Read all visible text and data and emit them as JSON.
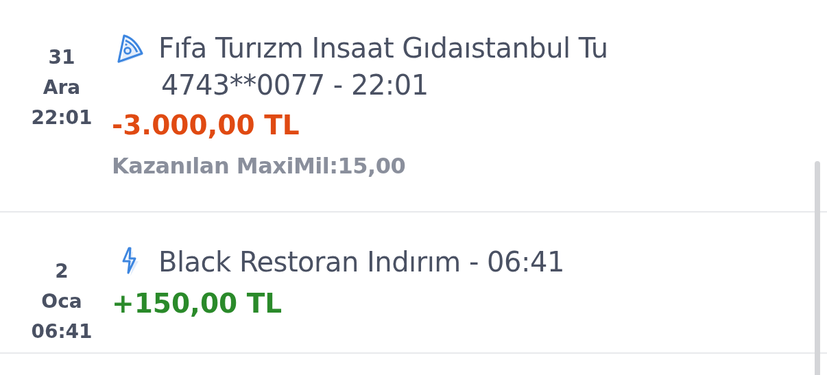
{
  "transactions": [
    {
      "day": "31",
      "month": "Ara",
      "time": "22:01",
      "kind": "pizza",
      "title": "Fıfa Turızm Insaat Gıdaıstanbul Tu",
      "detail": "4743**0077 - 22:01",
      "amount": "-3.000,00 TL",
      "color": "#e04a12",
      "reward": "Kazanılan MaxiMil:15,00"
    },
    {
      "day": "2",
      "month": "Oca",
      "time": "06:41",
      "kind": "bolt",
      "title": "Black Restoran Indırım - 06:41",
      "amount": "+150,00 TL",
      "color": "#2a8a2a"
    }
  ]
}
